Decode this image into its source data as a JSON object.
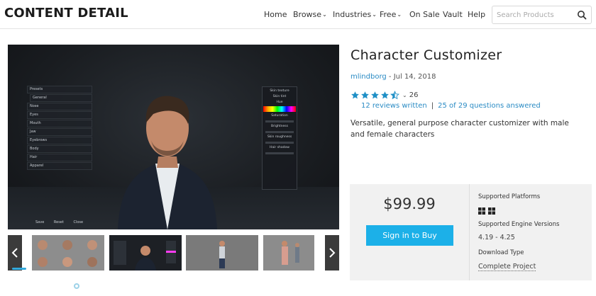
{
  "header": {
    "title": "CONTENT DETAIL",
    "nav": [
      {
        "label": "Home",
        "has_dropdown": false
      },
      {
        "label": "Browse",
        "has_dropdown": true
      },
      {
        "label": "Industries",
        "has_dropdown": true
      },
      {
        "label": "Free",
        "has_dropdown": true
      },
      {
        "label": "On Sale",
        "has_dropdown": false
      },
      {
        "label": "Vault",
        "has_dropdown": false
      },
      {
        "label": "Help",
        "has_dropdown": false
      }
    ],
    "search": {
      "placeholder": "Search Products",
      "value": ""
    }
  },
  "preview": {
    "overlay_left": [
      "Presets",
      "General",
      "Nose",
      "Eyes",
      "Mouth",
      "Jaw",
      "Eyebrows",
      "Body",
      "Hair",
      "Apparel"
    ],
    "overlay_buttons": [
      "Save",
      "Reset",
      "Close"
    ],
    "overlay_right": [
      "Skin texture",
      "Skin tint",
      "Hue",
      "Saturation",
      "Brightness",
      "Skin roughness",
      "Hair shadow"
    ]
  },
  "product": {
    "title": "Character Customizer",
    "author": "mlindborg",
    "date_sep": " - ",
    "date": "Jul 14, 2018",
    "rating": 4.5,
    "rating_count": "26",
    "reviews_label": "12 reviews written",
    "questions_label": "25 of 29 questions answered",
    "separator": "|",
    "description": "Versatile, general purpose character customizer with male and female characters"
  },
  "purchase": {
    "price": "$99.99",
    "buy_label": "Sign in to Buy",
    "platforms_label": "Supported Platforms",
    "platform_icons": [
      "windows-icon",
      "windows-icon"
    ],
    "engine_label": "Supported Engine Versions",
    "engine_value": "4.19 - 4.25",
    "download_label": "Download Type",
    "download_value": "Complete Project"
  },
  "colors": {
    "accent": "#1cb0e8",
    "link": "#2a8bc4",
    "star": "#1e8fc6",
    "box_bg": "#f1f1f1"
  }
}
